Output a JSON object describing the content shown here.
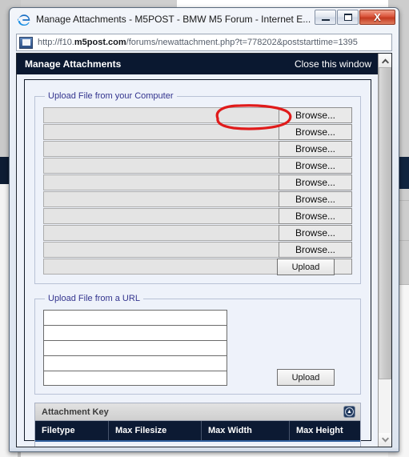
{
  "window": {
    "title": "Manage Attachments - M5POST - BMW M5 Forum - Internet E...",
    "app_icon": "internet-explorer-icon",
    "minimize_label": "Minimize",
    "maximize_label": "Maximize",
    "close_label": "X"
  },
  "address_bar": {
    "icon": "page-icon",
    "url_prefix": "http://f10.",
    "url_domain": "m5post.com",
    "url_suffix": "/forums/newattachment.php?t=778202&poststarttime=1395"
  },
  "forum": {
    "header_title": "Manage Attachments",
    "close_link": "Close this window"
  },
  "upload_computer": {
    "legend": "Upload File from your Computer",
    "browse_label": "Browse...",
    "rows": [
      {
        "value": ""
      },
      {
        "value": ""
      },
      {
        "value": ""
      },
      {
        "value": ""
      },
      {
        "value": ""
      },
      {
        "value": ""
      },
      {
        "value": ""
      },
      {
        "value": ""
      },
      {
        "value": ""
      },
      {
        "value": ""
      }
    ],
    "upload_label": "Upload"
  },
  "upload_url": {
    "legend": "Upload File from a URL",
    "fields": [
      {
        "value": ""
      },
      {
        "value": ""
      },
      {
        "value": ""
      },
      {
        "value": ""
      },
      {
        "value": ""
      }
    ],
    "upload_label": "Upload"
  },
  "attachment_key": {
    "title": "Attachment Key",
    "collapse_icon": "collapse-icon",
    "columns": [
      "Filetype",
      "Max Filesize",
      "Max Width",
      "Max Height"
    ],
    "rows": []
  },
  "scrollbar": {
    "up_icon": "chevron-up-icon",
    "down_icon": "chevron-down-icon"
  },
  "annotation": {
    "type": "hand-drawn-red-ellipse",
    "color": "#e01b1b",
    "target": "first-browse-button"
  },
  "colors": {
    "header_navy": "#0a1830",
    "legend_blue": "#33348e",
    "annotation_red": "#e01b1b",
    "close_red": "#c33a20"
  }
}
